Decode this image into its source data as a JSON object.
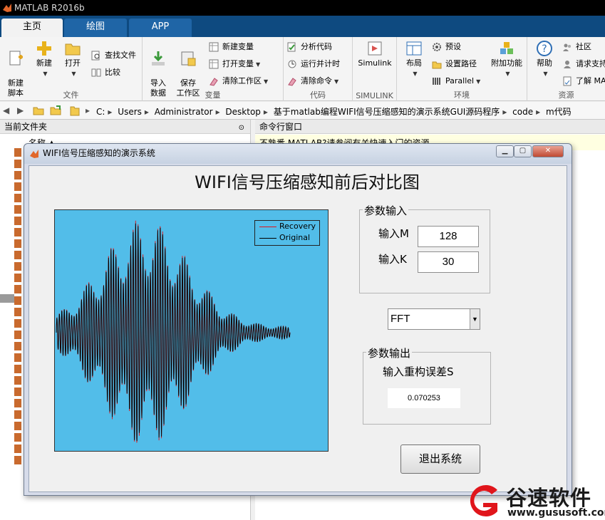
{
  "matlab": {
    "title": "MATLAB R2016b",
    "tabs": [
      {
        "label": "主页",
        "active": true
      },
      {
        "label": "绘图",
        "active": false
      },
      {
        "label": "APP",
        "active": false
      }
    ],
    "ribbon": {
      "file": {
        "label": "文件",
        "new_script": "新建\n脚本",
        "new": "新建",
        "open": "打开",
        "find_files": "查找文件",
        "compare": "比较"
      },
      "variable": {
        "label": "变量",
        "import": "导入\n数据",
        "save_ws": "保存\n工作区",
        "new_var": "新建变量",
        "open_var": "打开变量",
        "clear_ws": "清除工作区"
      },
      "code": {
        "label": "代码",
        "analyze": "分析代码",
        "run_time": "运行并计时",
        "clear_cmd": "清除命令"
      },
      "simulink": {
        "label": "SIMULINK",
        "btn": "Simulink"
      },
      "env": {
        "label": "环境",
        "layout": "布局",
        "prefs": "预设",
        "set_path": "设置路径",
        "parallel": "Parallel",
        "addons": "附加功能"
      },
      "resources": {
        "label": "资源",
        "help": "帮助",
        "community": "社区",
        "request_support": "请求支持",
        "learn": "了解 MA"
      }
    },
    "address": {
      "crumbs": [
        "C:",
        "Users",
        "Administrator",
        "Desktop",
        "基于matlab编程WIFI信号压缩感知的演示系统GUI源码程序",
        "code",
        "m代码"
      ]
    },
    "left_panel": {
      "title": "当前文件夹",
      "col_name": "名称 ▲"
    },
    "right_panel": {
      "title": "命令行窗口",
      "note": "不熟悉 MATLAB?请参阅有关快速入门的资源。"
    }
  },
  "gui": {
    "window_title": "WIFI信号压缩感知的演示系统",
    "main_title": "WIFI信号压缩感知前后对比图",
    "legend": [
      {
        "label": "Recovery",
        "color": "#e0151b"
      },
      {
        "label": "Original",
        "color": "#000000"
      }
    ],
    "param_input": {
      "title": "参数输入",
      "m_label": "输入M",
      "m_value": "128",
      "k_label": "输入K",
      "k_value": "30"
    },
    "method": {
      "selected": "FFT"
    },
    "param_output": {
      "title": "参数输出",
      "s_label": "输入重构误差S",
      "s_value": "0.070253"
    },
    "exit_label": "退出系统",
    "axes_bg": "#52bde9"
  },
  "watermark": {
    "brand": "谷速软件",
    "url": "www.gususoft.com",
    "color": "#e0151b"
  }
}
